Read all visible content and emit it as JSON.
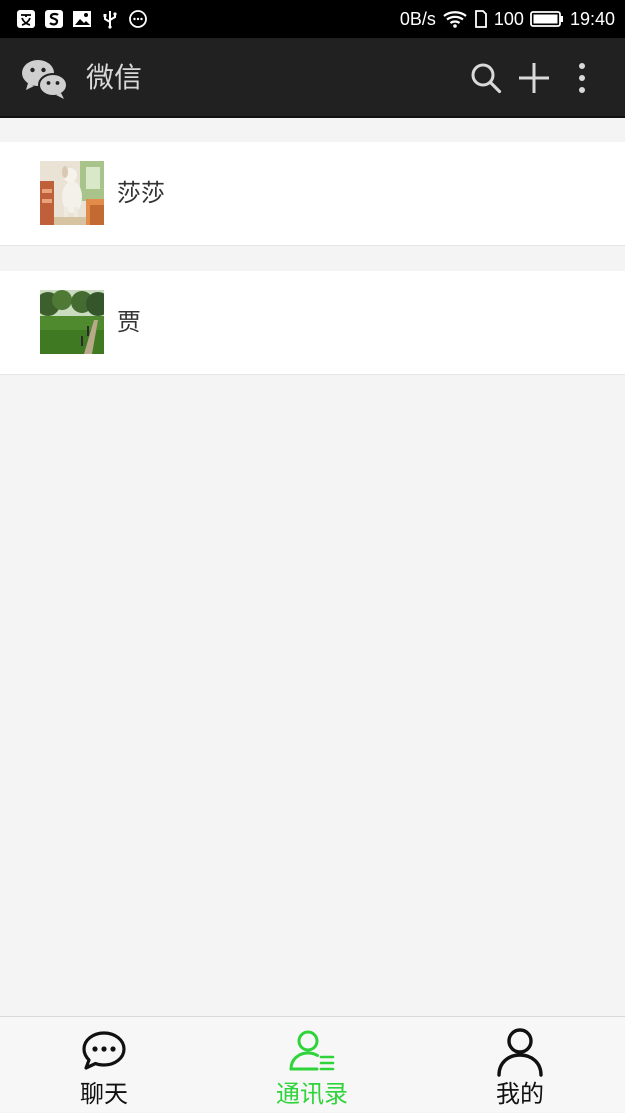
{
  "status_bar": {
    "network_speed": "0B/s",
    "battery": "100",
    "time": "19:40"
  },
  "app_bar": {
    "title": "微信",
    "icons": [
      "wechat-logo-icon",
      "search-icon",
      "plus-icon",
      "more-vertical-icon"
    ]
  },
  "contacts": [
    {
      "name": "莎莎",
      "avatar": "photo-avatar-dog"
    },
    {
      "name": "贾",
      "avatar": "photo-avatar-park"
    }
  ],
  "tabs": [
    {
      "label": "聊天",
      "icon": "chat-bubble-icon",
      "active": false
    },
    {
      "label": "通讯录",
      "icon": "contacts-icon",
      "active": true
    },
    {
      "label": "我的",
      "icon": "person-icon",
      "active": false
    }
  ],
  "colors": {
    "accent": "#2fd33a",
    "app_bar": "#212121",
    "status_bar": "#000000",
    "background": "#f4f4f4"
  }
}
